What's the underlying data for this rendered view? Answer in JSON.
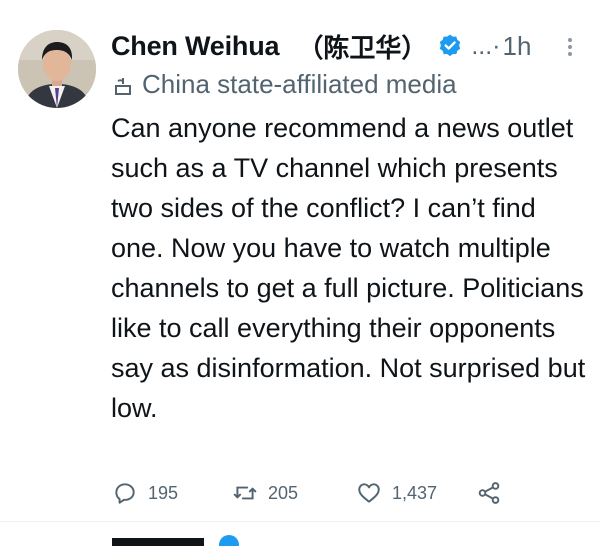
{
  "tweet": {
    "display_name": "Chen Weihua",
    "display_name_cn": "（陈卫华）",
    "handle": "...·",
    "timestamp": "1h",
    "account_label": "China state-affiliated media",
    "body": "Can anyone recommend a news outlet such as a TV channel which presents two sides of the conflict? I can’t find one. Now you have to watch multiple channels to get a full picture. Politicians like to call everything their opponents say as disinformation. Not surprised but low.",
    "replies": "195",
    "retweets": "205",
    "likes": "1,437"
  },
  "colors": {
    "verified_blue": "#1d9bf0",
    "secondary_text": "#536471",
    "primary_text": "#0f1419"
  },
  "icons": [
    "verified-badge-icon",
    "more-options-icon",
    "state-media-icon",
    "reply-icon",
    "retweet-icon",
    "like-icon",
    "share-icon"
  ]
}
